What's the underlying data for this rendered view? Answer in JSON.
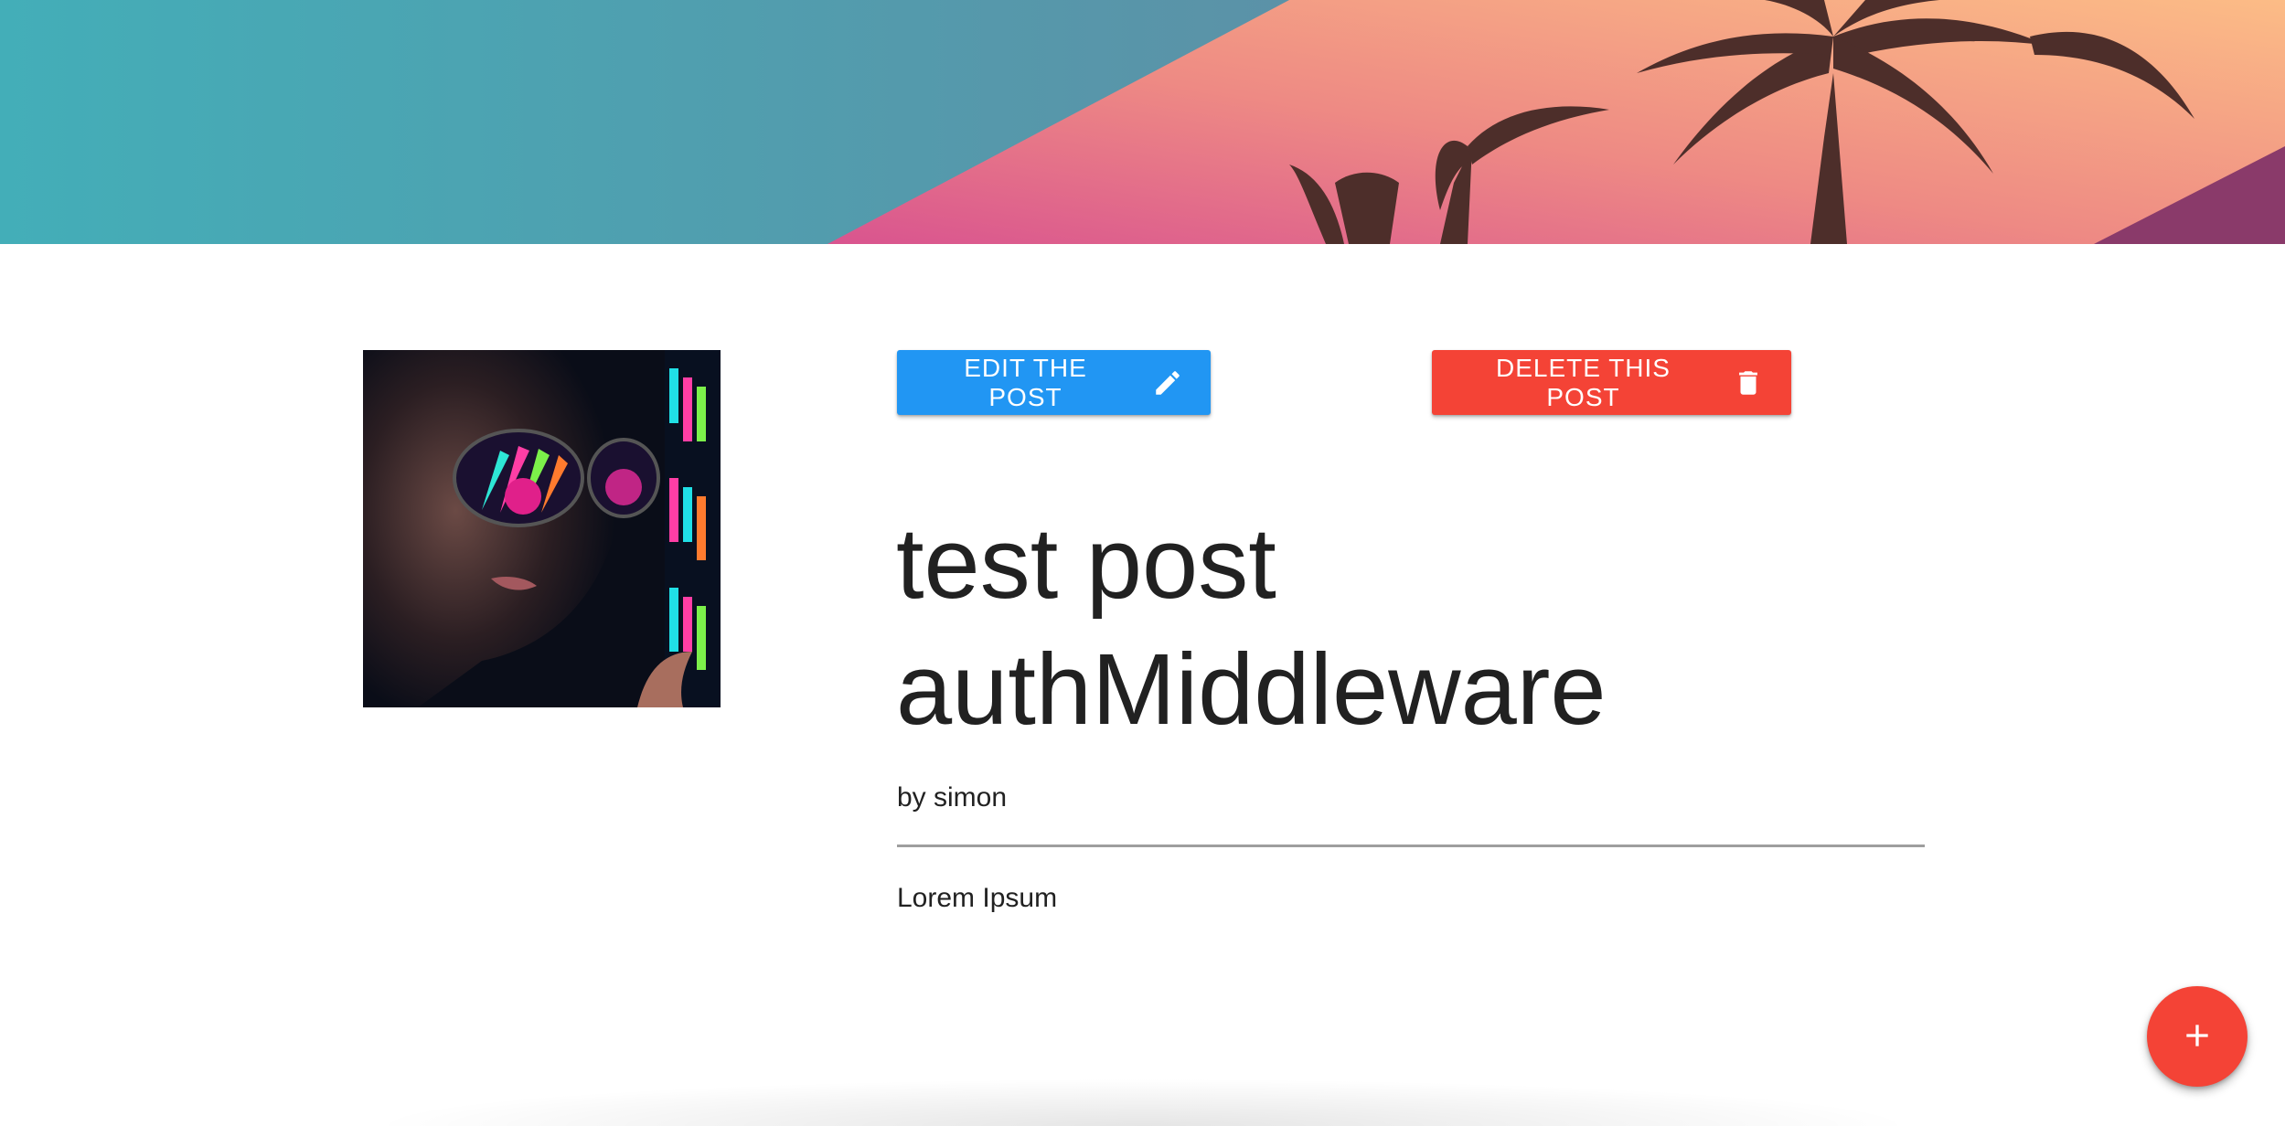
{
  "post": {
    "title": "test post authMiddleware",
    "author_line": "by simon",
    "body": "Lorem Ipsum"
  },
  "actions": {
    "edit_label": "EDIT THE POST",
    "edit_icon": "pencil-icon",
    "delete_label": "DELETE THIS POST",
    "delete_icon": "trash-icon",
    "fab_icon": "plus-icon"
  },
  "colors": {
    "edit_button": "#2196f3",
    "delete_button": "#f44336",
    "fab": "#f44336",
    "text": "#212121",
    "divider": "#9e9e9e"
  }
}
